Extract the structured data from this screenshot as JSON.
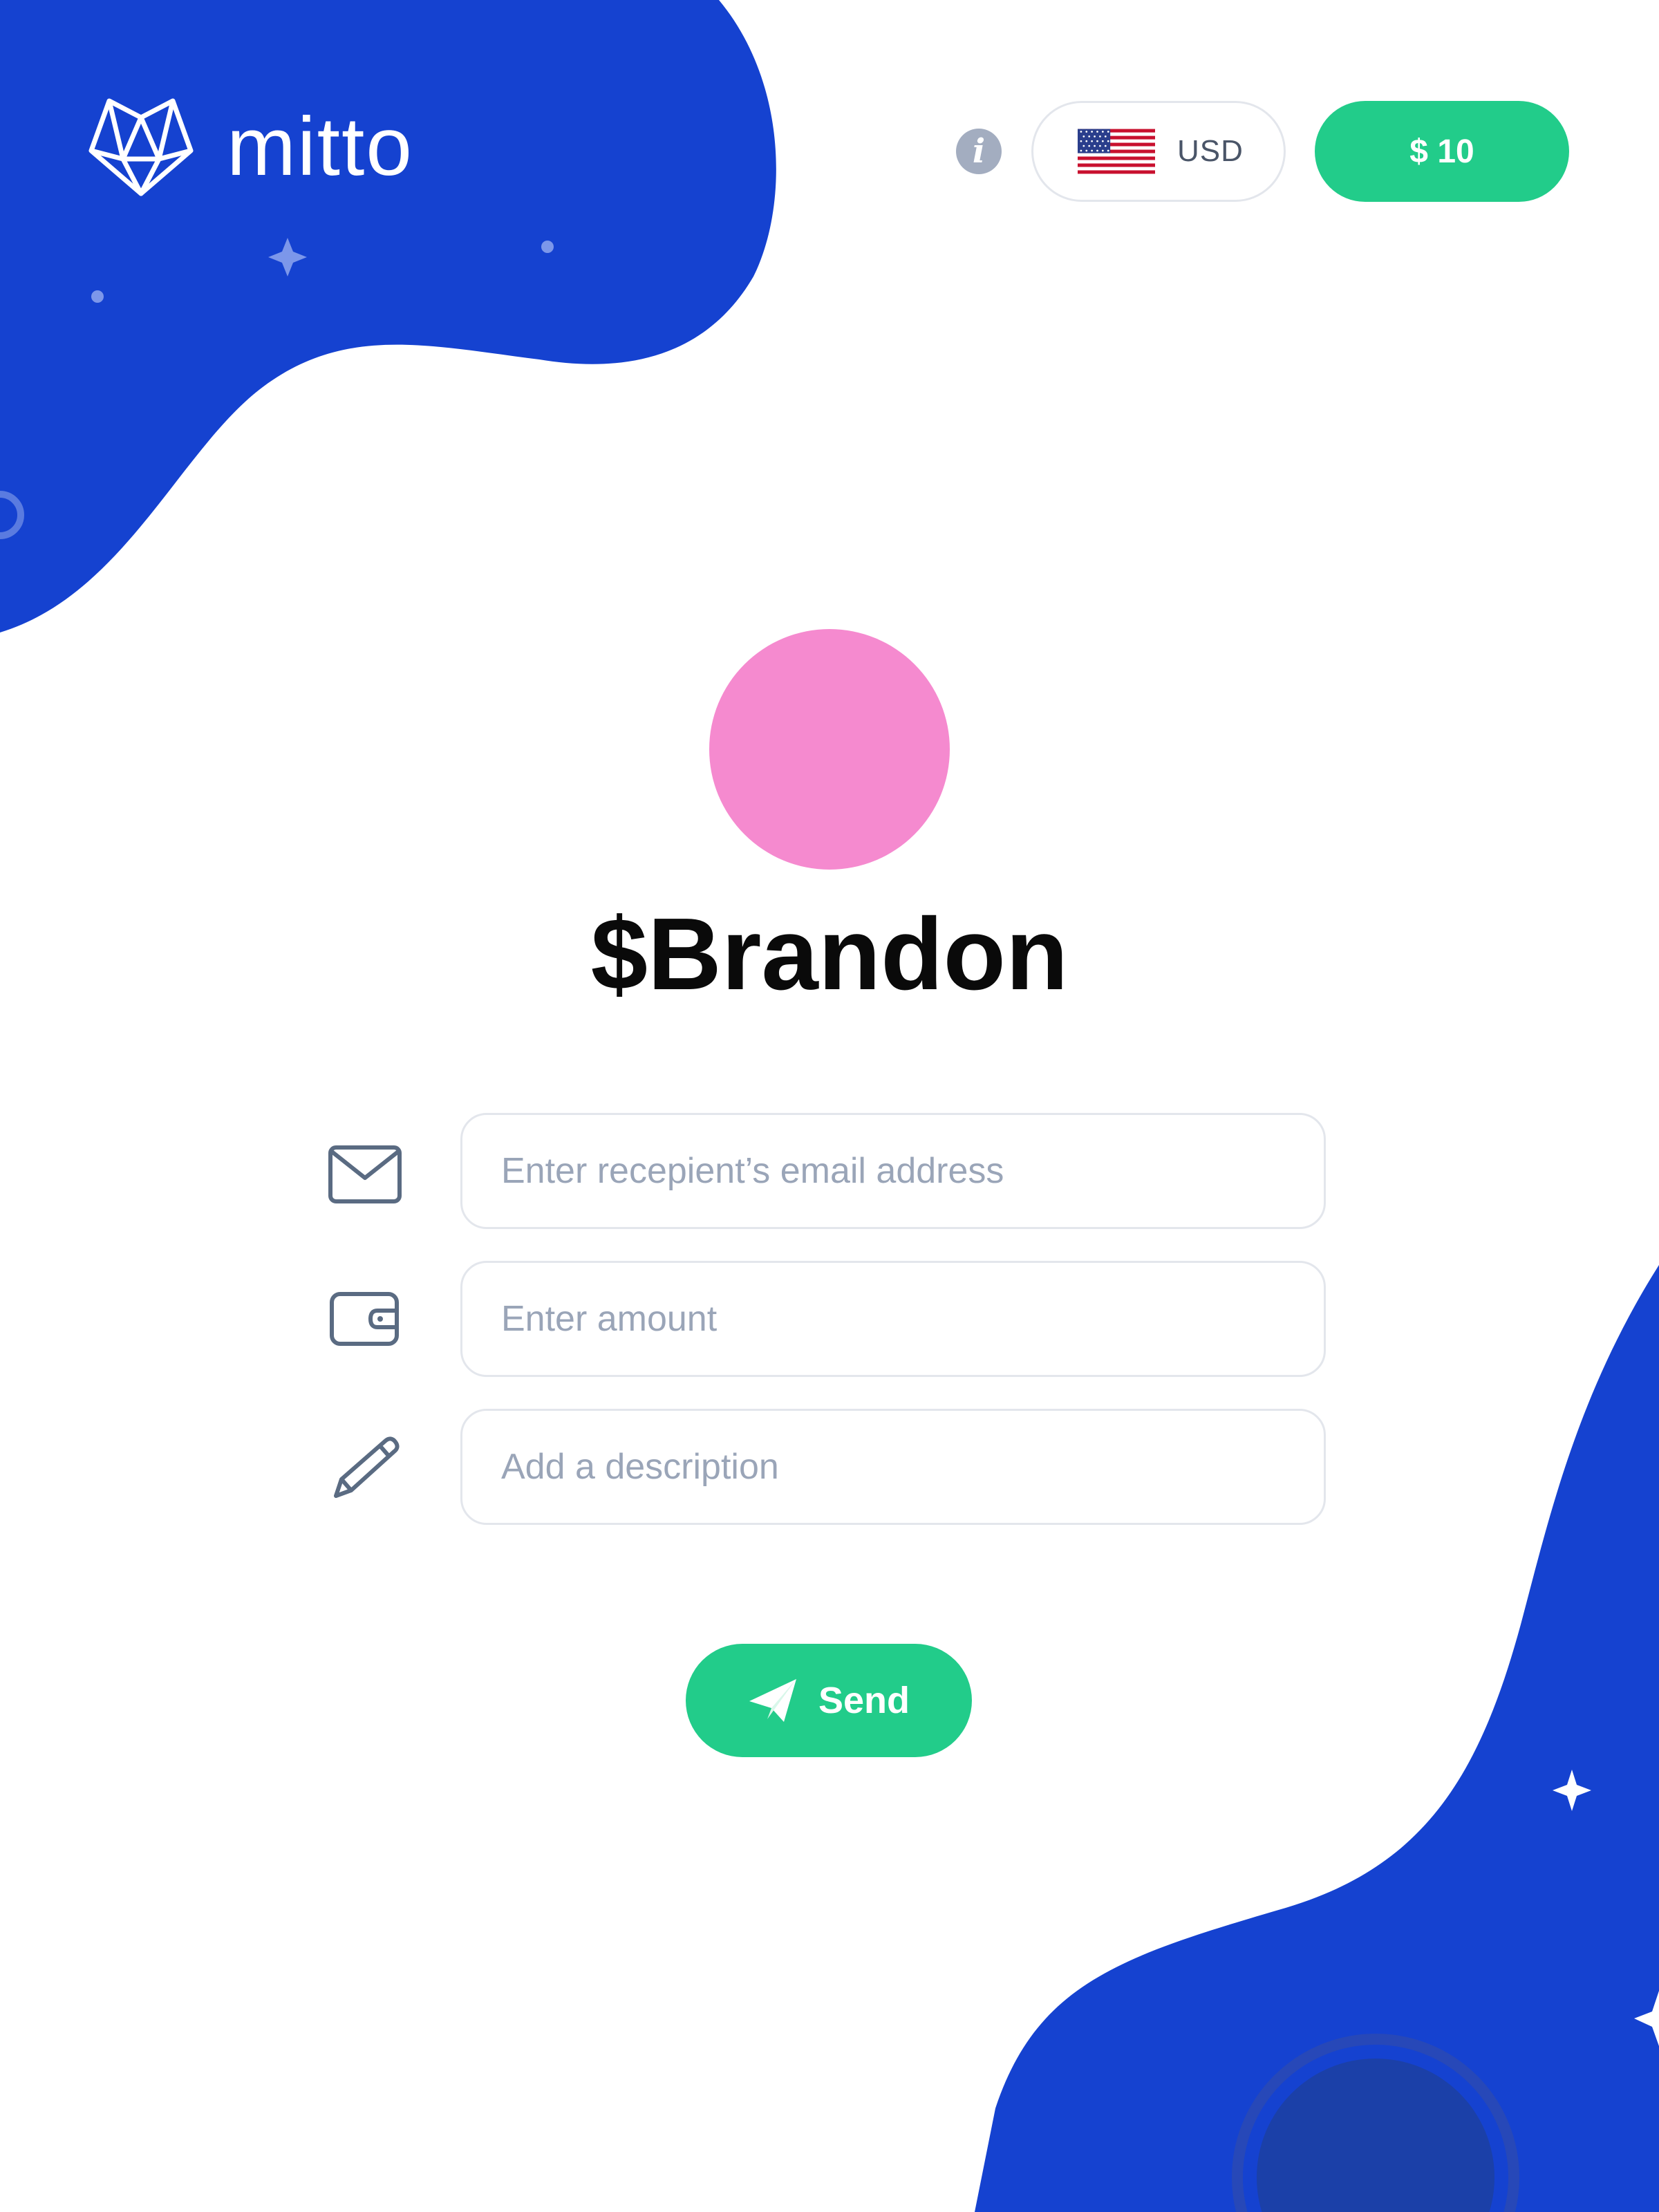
{
  "brand": {
    "name": "mitto"
  },
  "header": {
    "currency": {
      "code": "USD",
      "flag": "us-flag-icon"
    },
    "balance_label": "$ 10"
  },
  "profile": {
    "name": "$Brandon",
    "avatar_color": "#f58acf"
  },
  "form": {
    "email_placeholder": "Enter recepient’s email address",
    "amount_placeholder": "Enter amount",
    "description_placeholder": "Add a description"
  },
  "actions": {
    "send_label": "Send"
  },
  "colors": {
    "brand_blue": "#1542d0",
    "accent_green": "#22cc8a",
    "muted_text": "#9aa5b8"
  }
}
